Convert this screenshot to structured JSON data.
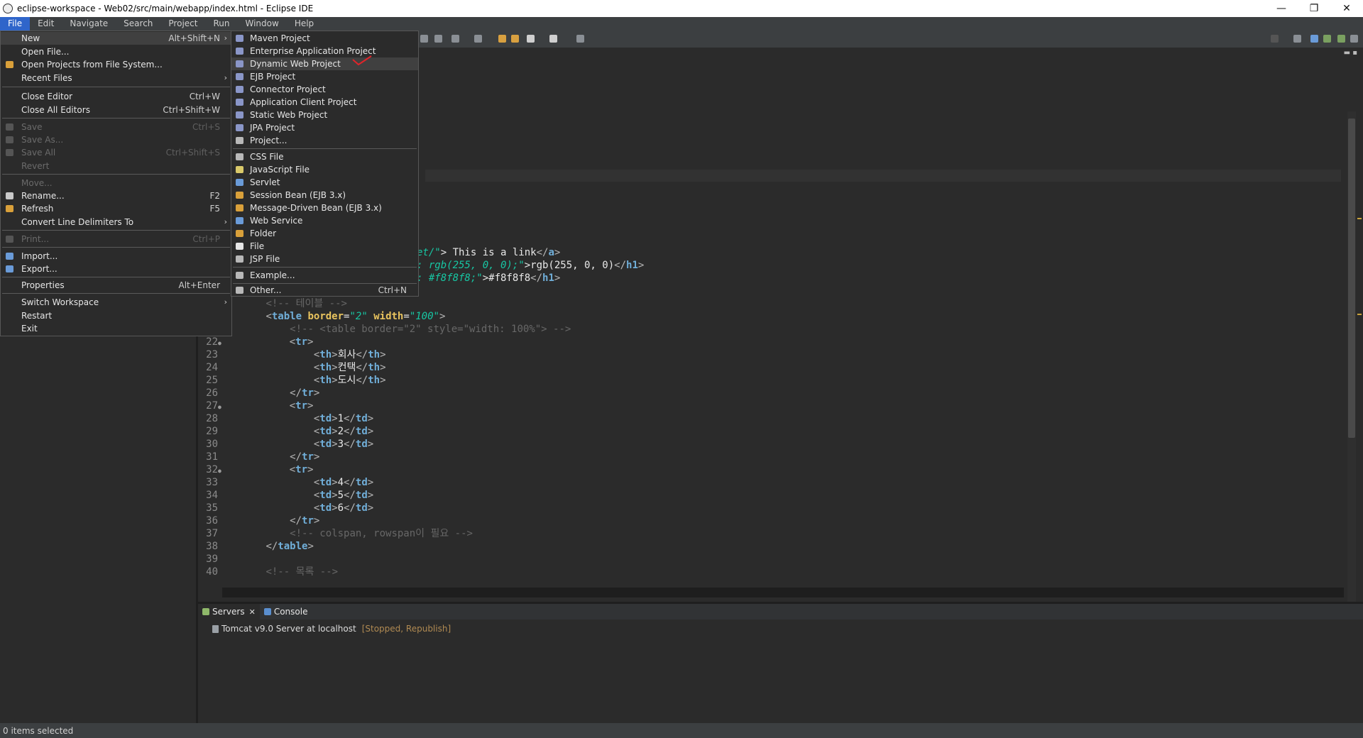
{
  "window": {
    "title": "eclipse-workspace - Web02/src/main/webapp/index.html - Eclipse IDE",
    "controls": [
      "—",
      "❐",
      "✕"
    ]
  },
  "menubar": [
    "File",
    "Edit",
    "Navigate",
    "Search",
    "Project",
    "Run",
    "Window",
    "Help"
  ],
  "file_menu": {
    "items": [
      {
        "label": "New",
        "accel": "Alt+Shift+N",
        "submenu": true
      },
      {
        "label": "Open File...",
        "accel": ""
      },
      {
        "label": "Open Projects from File System...",
        "accel": ""
      },
      {
        "label": "Recent Files",
        "accel": "",
        "submenu": true
      },
      {
        "label": "Close Editor",
        "accel": "Ctrl+W"
      },
      {
        "label": "Close All Editors",
        "accel": "Ctrl+Shift+W"
      },
      {
        "label": "Save",
        "accel": "Ctrl+S",
        "disabled": true
      },
      {
        "label": "Save As...",
        "accel": "",
        "disabled": true
      },
      {
        "label": "Save All",
        "accel": "Ctrl+Shift+S",
        "disabled": true
      },
      {
        "label": "Revert",
        "accel": "",
        "disabled": true
      },
      {
        "label": "Move...",
        "accel": "",
        "disabled": true
      },
      {
        "label": "Rename...",
        "accel": "F2"
      },
      {
        "label": "Refresh",
        "accel": "F5"
      },
      {
        "label": "Convert Line Delimiters To",
        "accel": "",
        "submenu": true
      },
      {
        "label": "Print...",
        "accel": "Ctrl+P",
        "disabled": true
      },
      {
        "label": "Import...",
        "accel": ""
      },
      {
        "label": "Export...",
        "accel": ""
      },
      {
        "label": "Properties",
        "accel": "Alt+Enter"
      },
      {
        "label": "Switch Workspace",
        "accel": "",
        "submenu": true
      },
      {
        "label": "Restart",
        "accel": ""
      },
      {
        "label": "Exit",
        "accel": ""
      }
    ]
  },
  "new_submenu": {
    "items": [
      {
        "label": "Maven Project",
        "accel": ""
      },
      {
        "label": "Enterprise Application Project",
        "accel": ""
      },
      {
        "label": "Dynamic Web Project",
        "accel": ""
      },
      {
        "label": "EJB Project",
        "accel": ""
      },
      {
        "label": "Connector Project",
        "accel": ""
      },
      {
        "label": "Application Client Project",
        "accel": ""
      },
      {
        "label": "Static Web Project",
        "accel": ""
      },
      {
        "label": "JPA Project",
        "accel": ""
      },
      {
        "label": "Project...",
        "accel": ""
      },
      {
        "label": "CSS File",
        "accel": ""
      },
      {
        "label": "JavaScript File",
        "accel": ""
      },
      {
        "label": "Servlet",
        "accel": ""
      },
      {
        "label": "Session Bean (EJB 3.x)",
        "accel": ""
      },
      {
        "label": "Message-Driven Bean (EJB 3.x)",
        "accel": ""
      },
      {
        "label": "Web Service",
        "accel": ""
      },
      {
        "label": "Folder",
        "accel": ""
      },
      {
        "label": "File",
        "accel": ""
      },
      {
        "label": "JSP File",
        "accel": ""
      },
      {
        "label": "Example...",
        "accel": ""
      },
      {
        "label": "Other...",
        "accel": "Ctrl+N"
      }
    ]
  },
  "editor": {
    "visible_partial": {
      "l18_a": "et/\"",
      "l18_b": "> This is a link",
      "l19_a": ": rgb(255, 0, 0);\"",
      "l19_b": ">rgb(255, 0, 0)",
      "l20_a": ": #f8f8f8;\"",
      "l20_b": ">#f8f8f8",
      "gt": ">"
    },
    "lines": [
      {
        "n": "",
        "text": "<!-- 테이블 -->"
      },
      {
        "n": "",
        "text": "<table border=\"2\" width=\"100\">"
      },
      {
        "n": "",
        "text": "<!-- <table border=\"2\" style=\"width: 100%\"> -->"
      },
      {
        "n": "22",
        "text": "<tr>"
      },
      {
        "n": "23",
        "text": "회사"
      },
      {
        "n": "24",
        "text": "컨택"
      },
      {
        "n": "25",
        "text": "도시"
      },
      {
        "n": "26",
        "text": "</tr>"
      },
      {
        "n": "27",
        "text": "<tr>"
      },
      {
        "n": "28",
        "text": "1"
      },
      {
        "n": "29",
        "text": "2"
      },
      {
        "n": "30",
        "text": "3"
      },
      {
        "n": "31",
        "text": "</tr>"
      },
      {
        "n": "32",
        "text": "<tr>"
      },
      {
        "n": "33",
        "text": "4"
      },
      {
        "n": "34",
        "text": "5"
      },
      {
        "n": "35",
        "text": "6"
      },
      {
        "n": "36",
        "text": "</tr>"
      },
      {
        "n": "37",
        "text": "<!-- colspan, rowspan이 필요 -->"
      },
      {
        "n": "38",
        "text": "</table>"
      },
      {
        "n": "39",
        "text": ""
      },
      {
        "n": "40",
        "text": "<!-- 목록 -->"
      }
    ]
  },
  "bottom_panel": {
    "tabs": [
      {
        "label": "Servers",
        "active": true
      },
      {
        "label": "Console",
        "active": false
      }
    ],
    "server_name": "Tomcat v9.0 Server at localhost",
    "server_status": "[Stopped, Republish]"
  },
  "statusbar": {
    "text": "0 items selected"
  },
  "colors": {
    "accent": "#2f65ca",
    "background": "#2b2b2b",
    "tag": "#70aed8",
    "attr": "#e8c35e",
    "value": "#17c6a3",
    "comment": "#676767",
    "annotation_mark": "#e0242a"
  }
}
